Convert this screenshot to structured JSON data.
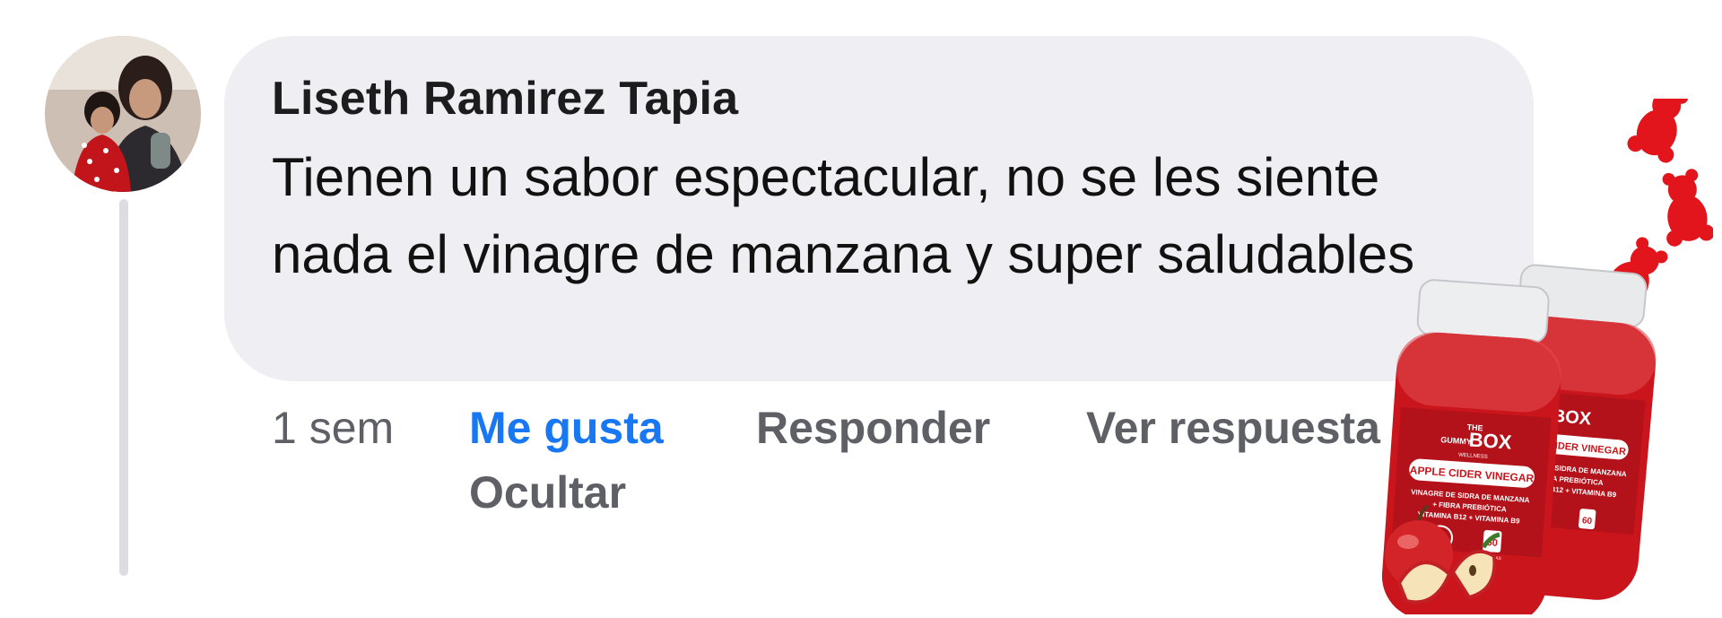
{
  "comment": {
    "author": "Liseth Ramirez Tapia",
    "text": "Tienen un sabor espectacular, no se les siente nada el vinagre de manzana y super saludables",
    "avatar_icon": "profile-photo",
    "accent_color": "#1877f2",
    "bubble_color": "#efeff3"
  },
  "actions": {
    "time": "1 sem",
    "like": "Me gusta",
    "reply": "Responder",
    "view_replies": "Ver respuesta",
    "hide": "Ocultar"
  },
  "product": {
    "brand_top": "THE",
    "brand_mid": "GUMMY",
    "brand_box": "BOX",
    "brand_sub": "WELLNESS",
    "name": "APPLE CIDER VINEGAR",
    "line1": "VINAGRE DE SIDRA DE MANZANA",
    "line2": "+ FIBRA PREBIÓTICA",
    "line3": "VITAMINA B12 + VITAMINA B9",
    "count": "60",
    "count_unit": "GOMITAS",
    "bottle_color": "#c9151b",
    "gummy_color": "#e3151c"
  }
}
